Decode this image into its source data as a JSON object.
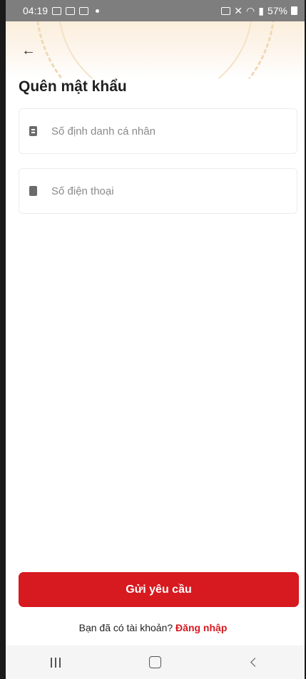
{
  "status_bar": {
    "time": "04:19",
    "battery": "57%"
  },
  "header": {
    "back_icon": "arrow-left-icon",
    "title": "Quên mật khẩu"
  },
  "form": {
    "id_field": {
      "placeholder": "Số định danh cá nhân",
      "value": "",
      "icon": "id-card-icon"
    },
    "phone_field": {
      "placeholder": "Số điện thoại",
      "value": "",
      "icon": "phone-icon"
    },
    "submit_label": "Gửi yêu cầu"
  },
  "footer": {
    "prompt": "Bạn đã có tài khoản?",
    "login_link": "Đăng nhập"
  },
  "colors": {
    "primary": "#d71920",
    "status_bar": "#7e7e7e"
  },
  "navigation_bar": {
    "recent_icon": "recent-apps-icon",
    "home_icon": "home-icon",
    "back_icon": "back-icon"
  }
}
